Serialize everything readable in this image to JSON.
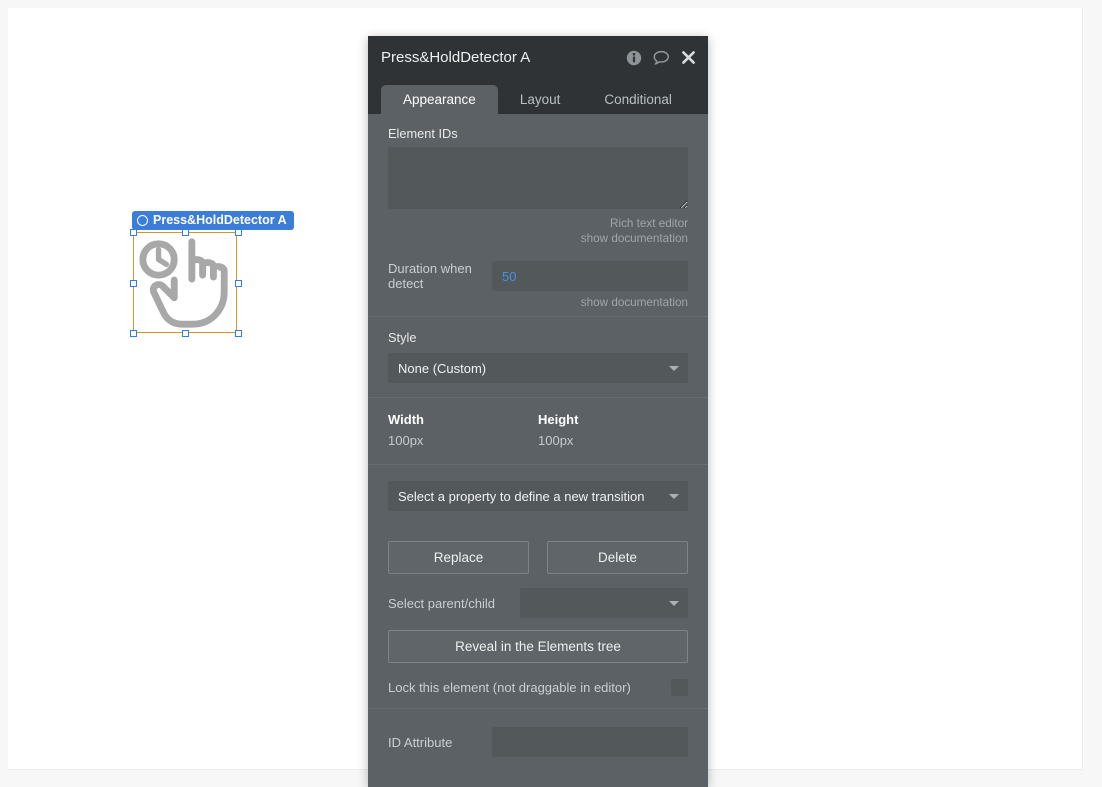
{
  "canvas": {
    "element": {
      "badge_label": "Press&HoldDetector A",
      "badge_icon": "circle-icon",
      "glyph": "press-and-hold-hand-clock-icon",
      "badge_color": "#3b7dd8",
      "selection_border_color": "#d8922a",
      "handle_color": "#2f7df4"
    }
  },
  "panel": {
    "title": "Press&HoldDetector A",
    "header_icons": [
      {
        "name": "info-icon"
      },
      {
        "name": "comment-icon"
      },
      {
        "name": "close-icon"
      }
    ],
    "tabs": [
      {
        "label": "Appearance",
        "active": true
      },
      {
        "label": "Layout",
        "active": false
      },
      {
        "label": "Conditional",
        "active": false
      }
    ],
    "element_ids": {
      "label": "Element IDs",
      "value": "",
      "hint_line1": "Rich text editor",
      "hint_line2": "show documentation"
    },
    "duration": {
      "label": "Duration when detect",
      "value": "50",
      "hint": "show documentation"
    },
    "style": {
      "label": "Style",
      "selected": "None (Custom)"
    },
    "dimensions": {
      "width_label": "Width",
      "width_value": "100px",
      "height_label": "Height",
      "height_value": "100px"
    },
    "transition": {
      "selected": "Select a property to define a new transition"
    },
    "buttons": {
      "replace": "Replace",
      "delete": "Delete",
      "reveal": "Reveal in the Elements tree"
    },
    "parent_child": {
      "label": "Select parent/child",
      "selected": ""
    },
    "lock": {
      "label": "Lock this element (not draggable in editor)",
      "checked": false
    },
    "id_attribute": {
      "label": "ID Attribute",
      "value": ""
    }
  }
}
